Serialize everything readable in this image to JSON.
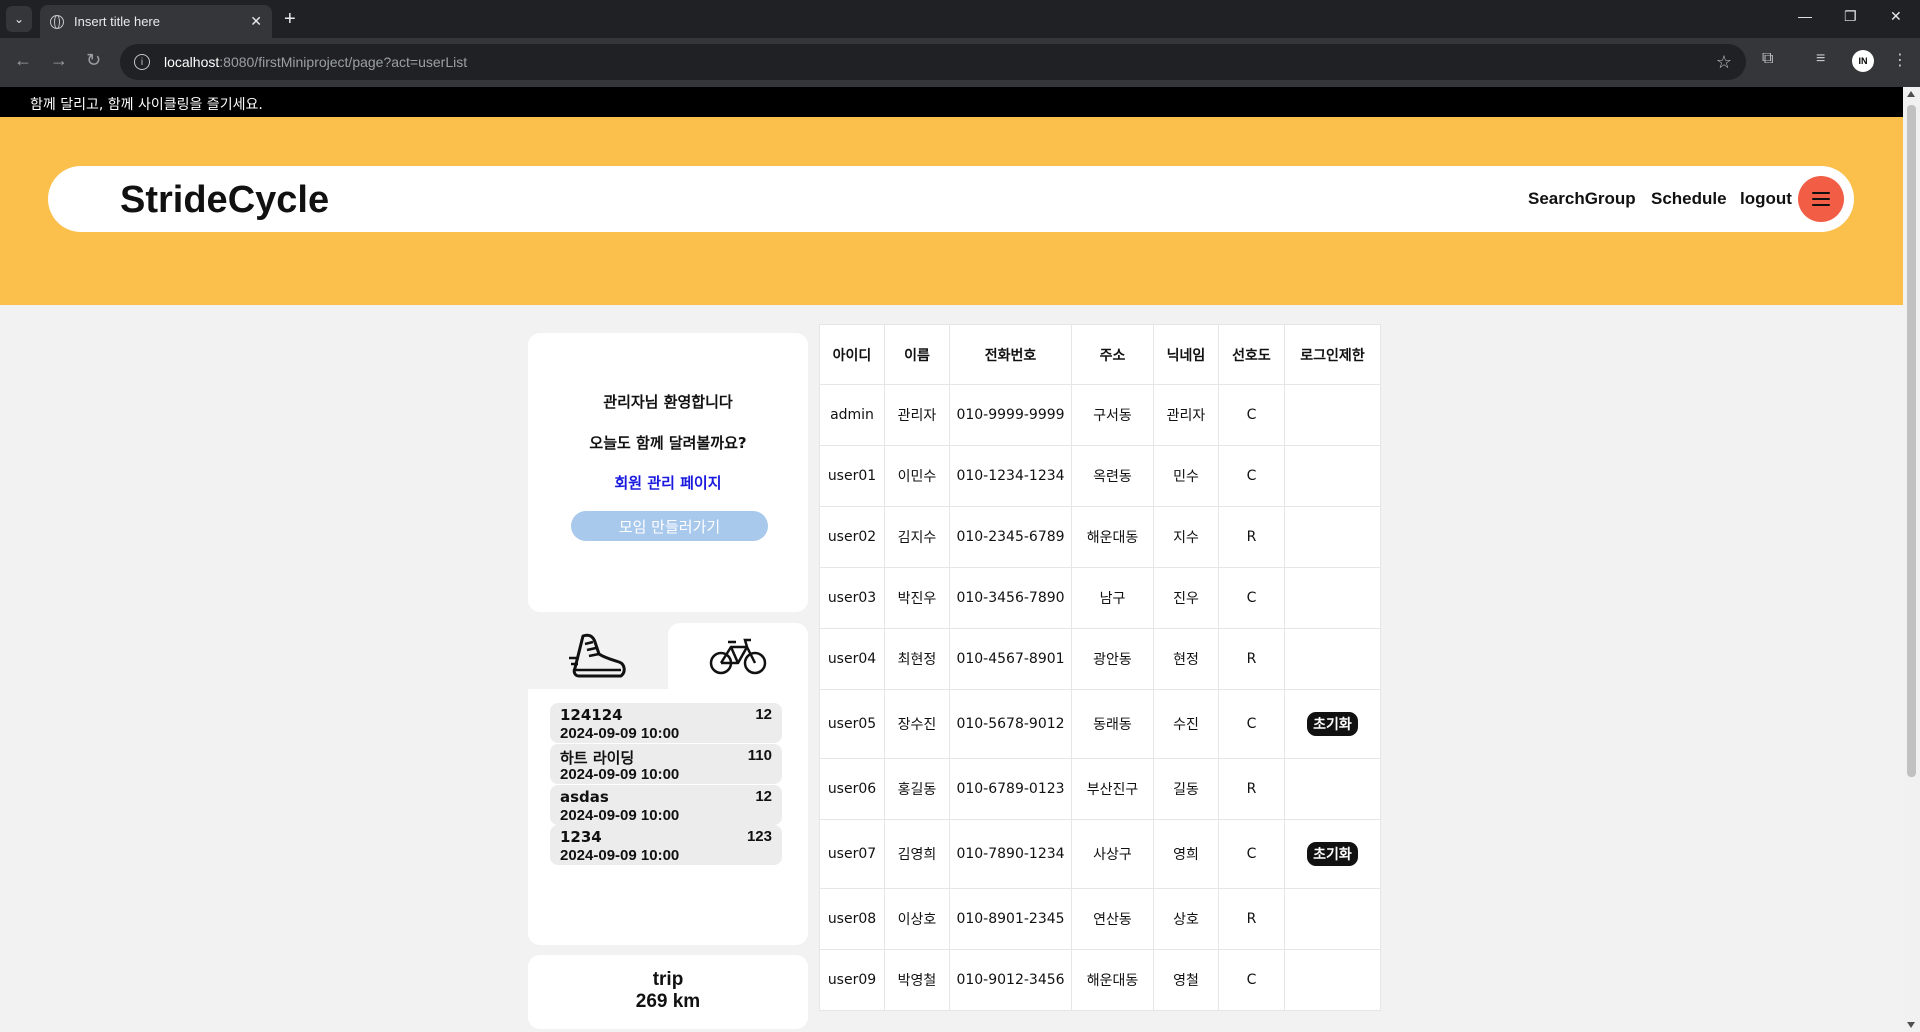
{
  "browser": {
    "tab_title": "Insert title here",
    "url_host": "localhost",
    "url_path": ":8080/firstMiniproject/page?act=userList",
    "profile_initials": "IN"
  },
  "site": {
    "tagline": "함께 달리고, 함께 사이클링을 즐기세요.",
    "brand": "StrideCycle",
    "nav": {
      "search_group": "SearchGroup",
      "schedule": "Schedule",
      "logout": "logout"
    },
    "colors": {
      "hero": "#fbbf4c",
      "menu_button": "#f25e45",
      "admin_link": "#1a1adf",
      "create_button": "#a8c8ec"
    }
  },
  "welcome": {
    "greeting": "관리자님 환영합니다",
    "prompt": "오늘도 함께 달려볼까요?",
    "admin_link": "회원 관리 페이지",
    "create_group": "모임 만들러가기"
  },
  "activity_tabs": [
    {
      "icon": "running-shoe-icon",
      "selected": false
    },
    {
      "icon": "bicycle-icon",
      "selected": true
    }
  ],
  "events": [
    {
      "name": "124124",
      "count": "12",
      "date": "2024-09-09 10:00"
    },
    {
      "name": "하트 라이딩",
      "count": "110",
      "date": "2024-09-09 10:00"
    },
    {
      "name": "asdas",
      "count": "12",
      "date": "2024-09-09 10:00"
    },
    {
      "name": "1234",
      "count": "123",
      "date": "2024-09-09 10:00"
    }
  ],
  "trip": {
    "label": "trip",
    "value": "269 km"
  },
  "user_table": {
    "headers": [
      "아이디",
      "이름",
      "전화번호",
      "주소",
      "닉네임",
      "선호도",
      "로그인제한"
    ],
    "reset_label": "초기화",
    "rows": [
      {
        "id": "admin",
        "name": "관리자",
        "phone": "010-9999-9999",
        "address": "구서동",
        "nickname": "관리자",
        "pref": "C",
        "reset": false
      },
      {
        "id": "user01",
        "name": "이민수",
        "phone": "010-1234-1234",
        "address": "옥련동",
        "nickname": "민수",
        "pref": "C",
        "reset": false
      },
      {
        "id": "user02",
        "name": "김지수",
        "phone": "010-2345-6789",
        "address": "해운대동",
        "nickname": "지수",
        "pref": "R",
        "reset": false
      },
      {
        "id": "user03",
        "name": "박진우",
        "phone": "010-3456-7890",
        "address": "남구",
        "nickname": "진우",
        "pref": "C",
        "reset": false
      },
      {
        "id": "user04",
        "name": "최현정",
        "phone": "010-4567-8901",
        "address": "광안동",
        "nickname": "현정",
        "pref": "R",
        "reset": false
      },
      {
        "id": "user05",
        "name": "장수진",
        "phone": "010-5678-9012",
        "address": "동래동",
        "nickname": "수진",
        "pref": "C",
        "reset": true
      },
      {
        "id": "user06",
        "name": "홍길동",
        "phone": "010-6789-0123",
        "address": "부산진구",
        "nickname": "길동",
        "pref": "R",
        "reset": false
      },
      {
        "id": "user07",
        "name": "김영희",
        "phone": "010-7890-1234",
        "address": "사상구",
        "nickname": "영희",
        "pref": "C",
        "reset": true
      },
      {
        "id": "user08",
        "name": "이상호",
        "phone": "010-8901-2345",
        "address": "연산동",
        "nickname": "상호",
        "pref": "R",
        "reset": false
      },
      {
        "id": "user09",
        "name": "박영철",
        "phone": "010-9012-3456",
        "address": "해운대동",
        "nickname": "영철",
        "pref": "C",
        "reset": false
      }
    ]
  }
}
